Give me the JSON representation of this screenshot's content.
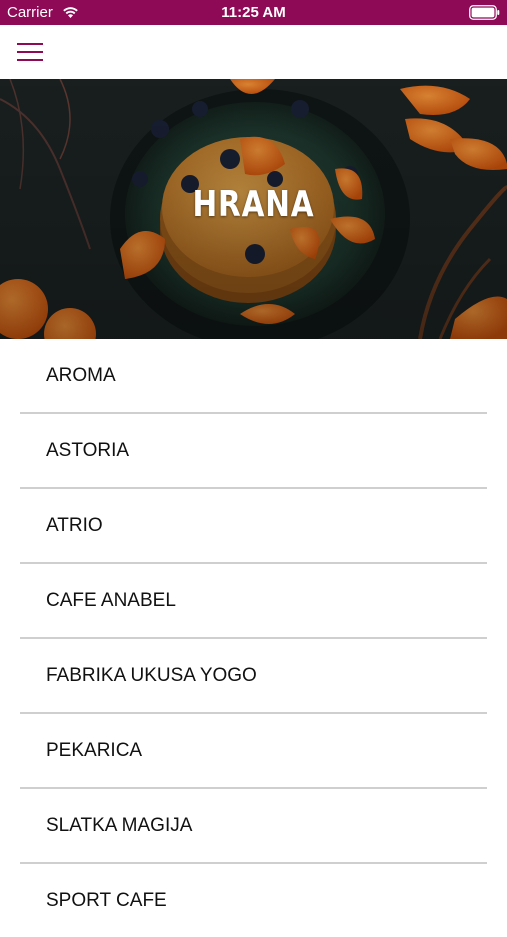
{
  "status_bar": {
    "carrier": "Carrier",
    "time": "11:25 AM",
    "color": "#8e0a57"
  },
  "nav": {
    "menu_icon": "hamburger-icon"
  },
  "hero": {
    "title": "HRANA"
  },
  "places": [
    {
      "label": "AROMA"
    },
    {
      "label": "ASTORIA"
    },
    {
      "label": "ATRIO"
    },
    {
      "label": "CAFE ANABEL"
    },
    {
      "label": "FABRIKA UKUSA YOGO"
    },
    {
      "label": "PEKARICA"
    },
    {
      "label": "SLATKA MAGIJA"
    },
    {
      "label": "SPORT CAFE"
    }
  ]
}
